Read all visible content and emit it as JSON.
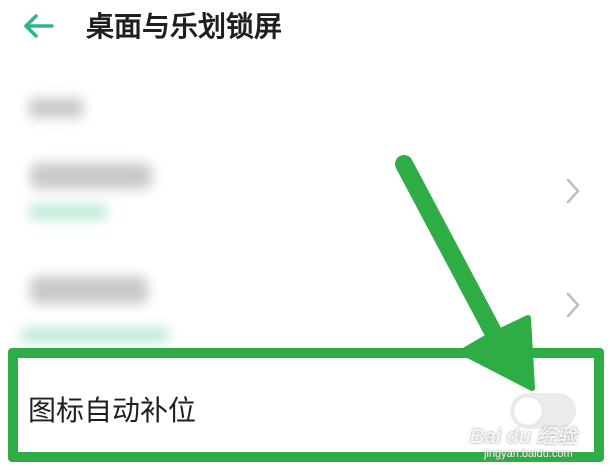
{
  "header": {
    "title": "桌面与乐划锁屏"
  },
  "settings": {
    "highlighted_item": {
      "label": "图标自动补位",
      "toggle_on": false
    }
  },
  "watermark": {
    "brand": "Bai du 经验",
    "url": "jingyan.baidu.com"
  },
  "colors": {
    "accent": "#2ead45",
    "back_arrow": "#2fb58a",
    "title_text": "#1f1f1f"
  },
  "icons": {
    "back": "arrow-left-icon",
    "chevron": "chevron-right-icon",
    "annotation": "annotation-arrow-icon"
  }
}
